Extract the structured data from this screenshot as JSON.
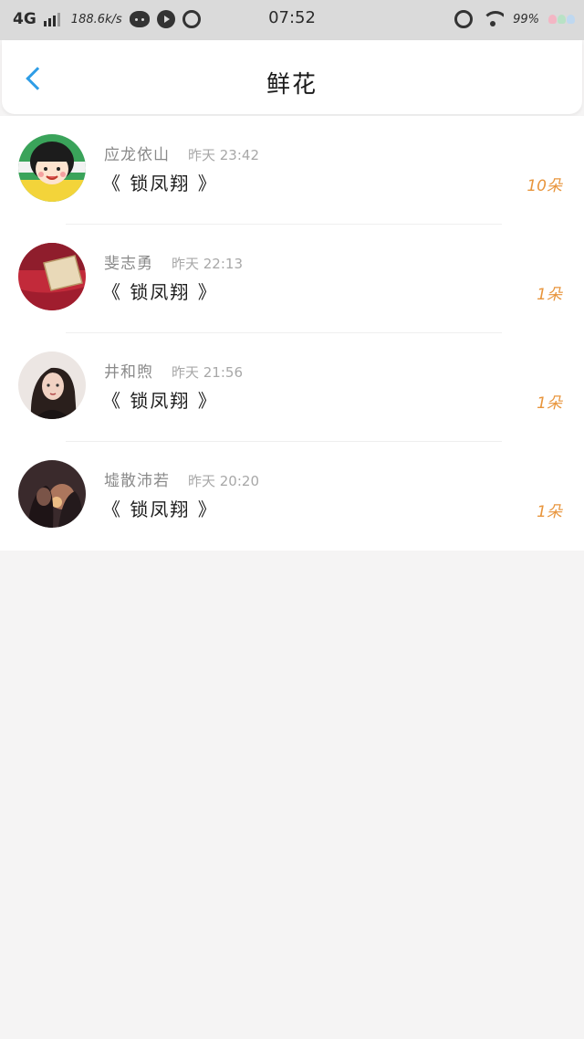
{
  "status_bar": {
    "network": "4G",
    "speed": "188.6k/s",
    "time": "07:52",
    "battery": "99%",
    "icons": [
      "signal-icon",
      "wechat-icon",
      "play-icon",
      "alarm-icon",
      "alarm-icon",
      "wifi-icon",
      "battery-icon"
    ]
  },
  "header": {
    "title": "鲜花",
    "back_icon": "chevron-left-icon",
    "accent_color": "#2f9de6"
  },
  "records": [
    {
      "name": "应龙依山",
      "time": "昨天 23:42",
      "target": "《 锁凤翔 》",
      "count": "10朵",
      "avatar": "cartoon-girl"
    },
    {
      "name": "斐志勇",
      "time": "昨天 22:13",
      "target": "《 锁凤翔 》",
      "count": "1朵",
      "avatar": "red-gift"
    },
    {
      "name": "井和煦",
      "time": "昨天 21:56",
      "target": "《 锁凤翔 》",
      "count": "1朵",
      "avatar": "woman-portrait"
    },
    {
      "name": "墟散沛若",
      "time": "昨天 20:20",
      "target": "《 锁凤翔 》",
      "count": "1朵",
      "avatar": "couple-dark"
    }
  ],
  "colors": {
    "count": "#e8953c",
    "name": "#8a8a8a",
    "time": "#a8a8a8",
    "background": "#f5f4f4"
  }
}
